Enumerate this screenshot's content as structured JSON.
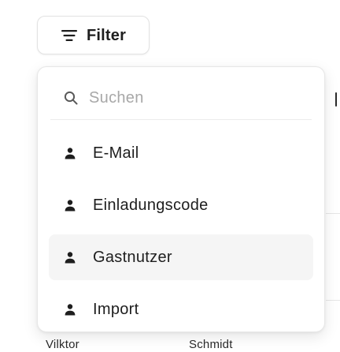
{
  "filter_button": {
    "label": "Filter",
    "icon": "filter-lines-icon"
  },
  "popover": {
    "search": {
      "placeholder": "Suchen",
      "value": "",
      "icon": "search-icon"
    },
    "items": [
      {
        "label": "E-Mail",
        "icon": "person-icon",
        "highlighted": false
      },
      {
        "label": "Einladungscode",
        "icon": "person-icon",
        "highlighted": false
      },
      {
        "label": "Gastnutzer",
        "icon": "person-icon",
        "highlighted": true
      },
      {
        "label": "Import",
        "icon": "person-icon",
        "highlighted": false
      }
    ]
  },
  "background": {
    "cell_1": "Vilktor",
    "cell_2": "Schmidt"
  },
  "colors": {
    "text": "#1e1e1e",
    "placeholder": "#a8a8a8",
    "border": "#e2e2e2",
    "hover_bg": "#f5f5f5"
  }
}
